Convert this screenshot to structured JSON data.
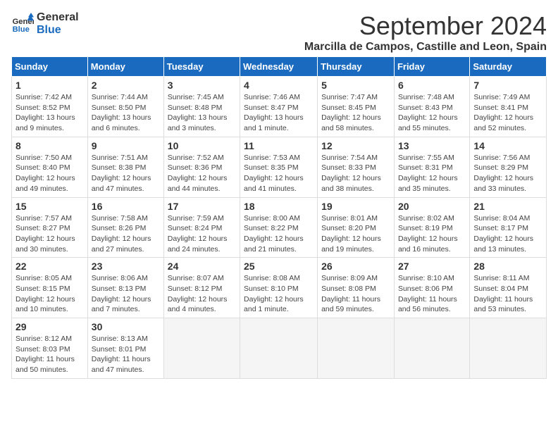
{
  "logo": {
    "line1": "General",
    "line2": "Blue"
  },
  "title": "September 2024",
  "location": "Marcilla de Campos, Castille and Leon, Spain",
  "days_of_week": [
    "Sunday",
    "Monday",
    "Tuesday",
    "Wednesday",
    "Thursday",
    "Friday",
    "Saturday"
  ],
  "weeks": [
    [
      {
        "day": 1,
        "rise": "7:42 AM",
        "set": "8:52 PM",
        "daylight": "13 hours and 9 minutes."
      },
      {
        "day": 2,
        "rise": "7:44 AM",
        "set": "8:50 PM",
        "daylight": "13 hours and 6 minutes."
      },
      {
        "day": 3,
        "rise": "7:45 AM",
        "set": "8:48 PM",
        "daylight": "13 hours and 3 minutes."
      },
      {
        "day": 4,
        "rise": "7:46 AM",
        "set": "8:47 PM",
        "daylight": "13 hours and 1 minute."
      },
      {
        "day": 5,
        "rise": "7:47 AM",
        "set": "8:45 PM",
        "daylight": "12 hours and 58 minutes."
      },
      {
        "day": 6,
        "rise": "7:48 AM",
        "set": "8:43 PM",
        "daylight": "12 hours and 55 minutes."
      },
      {
        "day": 7,
        "rise": "7:49 AM",
        "set": "8:41 PM",
        "daylight": "12 hours and 52 minutes."
      }
    ],
    [
      {
        "day": 8,
        "rise": "7:50 AM",
        "set": "8:40 PM",
        "daylight": "12 hours and 49 minutes."
      },
      {
        "day": 9,
        "rise": "7:51 AM",
        "set": "8:38 PM",
        "daylight": "12 hours and 47 minutes."
      },
      {
        "day": 10,
        "rise": "7:52 AM",
        "set": "8:36 PM",
        "daylight": "12 hours and 44 minutes."
      },
      {
        "day": 11,
        "rise": "7:53 AM",
        "set": "8:35 PM",
        "daylight": "12 hours and 41 minutes."
      },
      {
        "day": 12,
        "rise": "7:54 AM",
        "set": "8:33 PM",
        "daylight": "12 hours and 38 minutes."
      },
      {
        "day": 13,
        "rise": "7:55 AM",
        "set": "8:31 PM",
        "daylight": "12 hours and 35 minutes."
      },
      {
        "day": 14,
        "rise": "7:56 AM",
        "set": "8:29 PM",
        "daylight": "12 hours and 33 minutes."
      }
    ],
    [
      {
        "day": 15,
        "rise": "7:57 AM",
        "set": "8:27 PM",
        "daylight": "12 hours and 30 minutes."
      },
      {
        "day": 16,
        "rise": "7:58 AM",
        "set": "8:26 PM",
        "daylight": "12 hours and 27 minutes."
      },
      {
        "day": 17,
        "rise": "7:59 AM",
        "set": "8:24 PM",
        "daylight": "12 hours and 24 minutes."
      },
      {
        "day": 18,
        "rise": "8:00 AM",
        "set": "8:22 PM",
        "daylight": "12 hours and 21 minutes."
      },
      {
        "day": 19,
        "rise": "8:01 AM",
        "set": "8:20 PM",
        "daylight": "12 hours and 19 minutes."
      },
      {
        "day": 20,
        "rise": "8:02 AM",
        "set": "8:19 PM",
        "daylight": "12 hours and 16 minutes."
      },
      {
        "day": 21,
        "rise": "8:04 AM",
        "set": "8:17 PM",
        "daylight": "12 hours and 13 minutes."
      }
    ],
    [
      {
        "day": 22,
        "rise": "8:05 AM",
        "set": "8:15 PM",
        "daylight": "12 hours and 10 minutes."
      },
      {
        "day": 23,
        "rise": "8:06 AM",
        "set": "8:13 PM",
        "daylight": "12 hours and 7 minutes."
      },
      {
        "day": 24,
        "rise": "8:07 AM",
        "set": "8:12 PM",
        "daylight": "12 hours and 4 minutes."
      },
      {
        "day": 25,
        "rise": "8:08 AM",
        "set": "8:10 PM",
        "daylight": "12 hours and 1 minute."
      },
      {
        "day": 26,
        "rise": "8:09 AM",
        "set": "8:08 PM",
        "daylight": "11 hours and 59 minutes."
      },
      {
        "day": 27,
        "rise": "8:10 AM",
        "set": "8:06 PM",
        "daylight": "11 hours and 56 minutes."
      },
      {
        "day": 28,
        "rise": "8:11 AM",
        "set": "8:04 PM",
        "daylight": "11 hours and 53 minutes."
      }
    ],
    [
      {
        "day": 29,
        "rise": "8:12 AM",
        "set": "8:03 PM",
        "daylight": "11 hours and 50 minutes."
      },
      {
        "day": 30,
        "rise": "8:13 AM",
        "set": "8:01 PM",
        "daylight": "11 hours and 47 minutes."
      },
      null,
      null,
      null,
      null,
      null
    ]
  ]
}
